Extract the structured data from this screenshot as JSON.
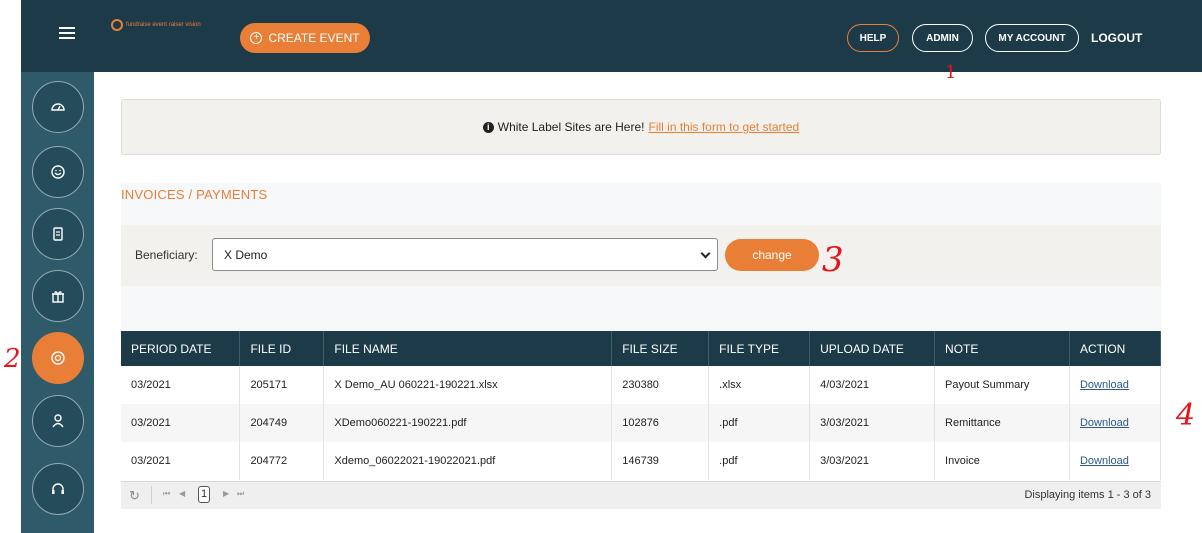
{
  "header": {
    "logo_text": "fundraise event raiser vision",
    "create_event_label": "CREATE EVENT",
    "nav": {
      "help": "HELP",
      "admin": "ADMIN",
      "my_account": "MY ACCOUNT",
      "logout": "LOGOUT"
    }
  },
  "sidebar": {
    "items": [
      {
        "icon": "dashboard-icon"
      },
      {
        "icon": "smiley-icon"
      },
      {
        "icon": "document-icon"
      },
      {
        "icon": "gift-icon"
      },
      {
        "icon": "dollar-icon",
        "active": true
      },
      {
        "icon": "user-icon"
      },
      {
        "icon": "headset-icon"
      }
    ]
  },
  "notice": {
    "text": "White Label Sites are Here!",
    "link": "Fill in this form to get started"
  },
  "section_title": "INVOICES / PAYMENTS",
  "beneficiary": {
    "label": "Beneficiary:",
    "selected": "X Demo",
    "change_label": "change"
  },
  "table": {
    "headers": [
      "PERIOD DATE",
      "FILE ID",
      "FILE NAME",
      "FILE SIZE",
      "FILE TYPE",
      "UPLOAD DATE",
      "NOTE",
      "ACTION"
    ],
    "rows": [
      [
        "03/2021",
        "205171",
        "X Demo_AU 060221-190221.xlsx",
        "230380",
        ".xlsx",
        "4/03/2021",
        "Payout Summary",
        "Download"
      ],
      [
        "03/2021",
        "204749",
        "XDemo060221-190221.pdf",
        "102876",
        ".pdf",
        "3/03/2021",
        "Remittance",
        "Download"
      ],
      [
        "03/2021",
        "204772",
        "Xdemo_06022021-19022021.pdf",
        "146739",
        ".pdf",
        "3/03/2021",
        "Invoice",
        "Download"
      ]
    ]
  },
  "pager": {
    "page": "1",
    "status": "Displaying items 1 - 3 of 3"
  },
  "annotations": [
    "1",
    "2",
    "3",
    "4"
  ],
  "colors": {
    "brand_orange": "#e97f36",
    "navy": "#1d3a48",
    "sidebar": "#2f5a6a",
    "annotation_red": "#e8141b"
  }
}
